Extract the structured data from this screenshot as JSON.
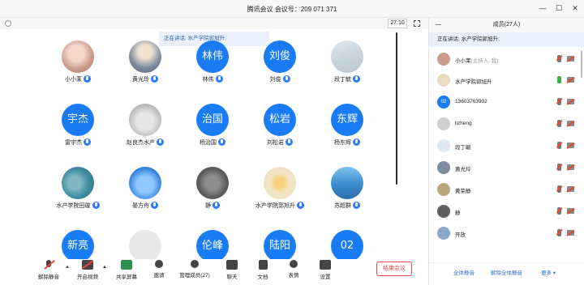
{
  "window": {
    "title": "腾讯会议 会议号：209 071 371",
    "controls": [
      "minimize-icon",
      "maximize-icon",
      "close-icon"
    ]
  },
  "topbar": {
    "timer": "27:10",
    "speaking": "正在讲话: 水产学院郭旭升;"
  },
  "participants": [
    {
      "name": "小小茉",
      "avatar_text": "",
      "style": "photo-a"
    },
    {
      "name": "黄光玲",
      "avatar_text": "",
      "style": "photo-b"
    },
    {
      "name": "林伟",
      "avatar_text": "林伟",
      "style": "blue"
    },
    {
      "name": "刘俊",
      "avatar_text": "刘俊",
      "style": "blue"
    },
    {
      "name": "段丁毓",
      "avatar_text": "",
      "style": "photo-c"
    },
    {
      "name": "雷宇杰",
      "avatar_text": "宇杰",
      "style": "blue"
    },
    {
      "name": "赵良杰水产",
      "avatar_text": "",
      "style": "photo-d"
    },
    {
      "name": "杨治国",
      "avatar_text": "治国",
      "style": "blue"
    },
    {
      "name": "刘松岩",
      "avatar_text": "松岩",
      "style": "blue"
    },
    {
      "name": "杨东辉",
      "avatar_text": "东辉",
      "style": "blue"
    },
    {
      "name": "水产学院田璇",
      "avatar_text": "",
      "style": "photo-e"
    },
    {
      "name": "晏方舟",
      "avatar_text": "",
      "style": "photo-f"
    },
    {
      "name": "静",
      "avatar_text": "",
      "style": "photo-g"
    },
    {
      "name": "水产学院郭旭升",
      "avatar_text": "",
      "style": "photo-h"
    },
    {
      "name": "苏超群",
      "avatar_text": "",
      "style": "photo-i"
    },
    {
      "name": "",
      "avatar_text": "新亮",
      "style": "blue"
    },
    {
      "name": "",
      "avatar_text": "",
      "style": "photo-j"
    },
    {
      "name": "",
      "avatar_text": "伦峰",
      "style": "blue"
    },
    {
      "name": "",
      "avatar_text": "陆阳",
      "style": "blue"
    },
    {
      "name": "",
      "avatar_text": "02",
      "style": "blue"
    }
  ],
  "toolbar": {
    "mute": "解除静音",
    "video": "开启视频",
    "share": "共享屏幕",
    "invite": "邀请",
    "manage": "管理成员(27)",
    "chat": "聊天",
    "doc": "文档",
    "emoji": "表情",
    "settings": "设置",
    "end": "结束会议"
  },
  "panel": {
    "title": "成员(27人)",
    "speaking": "正在讲话: 水产学院郭旭升;",
    "members": [
      {
        "name": "小小茉",
        "tag": "(主持人, 我)",
        "avatar_text": "",
        "mic": "muted"
      },
      {
        "name": "水产学院郭旭升",
        "tag": "",
        "avatar_text": "",
        "mic": "active"
      },
      {
        "name": "13603763902",
        "tag": "",
        "avatar_text": "02",
        "mic": "muted"
      },
      {
        "name": "lizheng",
        "tag": "",
        "avatar_text": "",
        "mic": "muted"
      },
      {
        "name": "段丁毓",
        "tag": "",
        "avatar_text": "",
        "mic": "muted"
      },
      {
        "name": "黄光玲",
        "tag": "",
        "avatar_text": "",
        "mic": "muted"
      },
      {
        "name": "黄荣静",
        "tag": "",
        "avatar_text": "",
        "mic": "muted"
      },
      {
        "name": "静",
        "tag": "",
        "avatar_text": "",
        "mic": "muted"
      },
      {
        "name": "开放",
        "tag": "",
        "avatar_text": "",
        "mic": "muted"
      }
    ],
    "mute_all": "全体静音",
    "unmute_all": "解除全体静音",
    "more": "更多 ▾"
  },
  "colors": {
    "accent": "#1a7cf5",
    "danger": "#e34a4a",
    "speaking_bg": "#e8f1fb"
  }
}
